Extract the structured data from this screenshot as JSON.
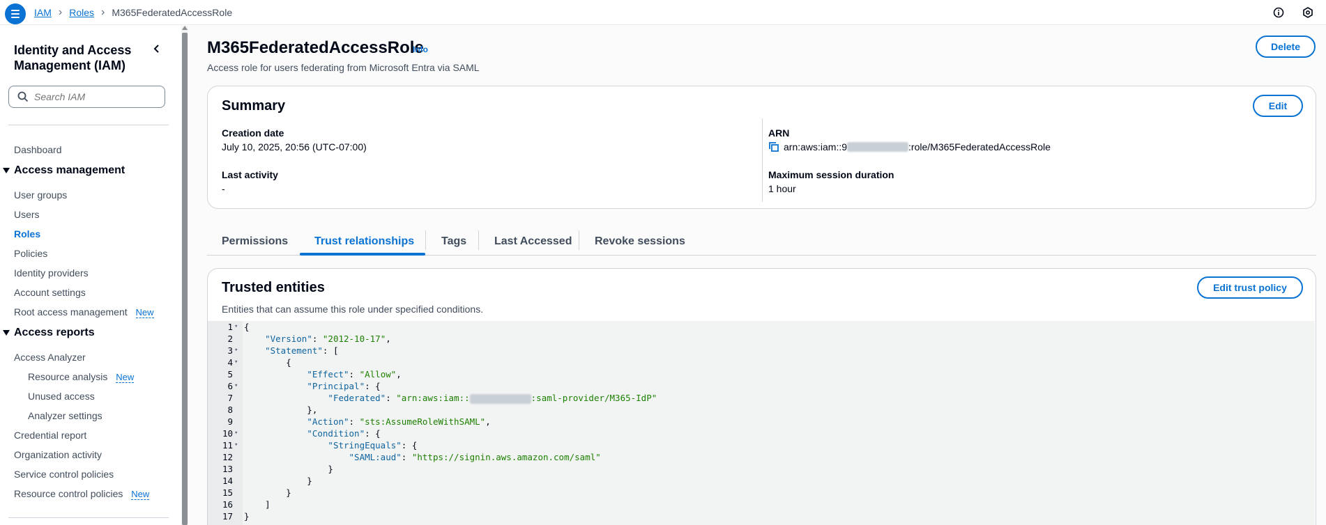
{
  "breadcrumb": [
    "IAM",
    "Roles",
    "M365FederatedAccessRole"
  ],
  "sidebar": {
    "title": "Identity and Access Management (IAM)",
    "search_placeholder": "Search IAM",
    "dashboard": "Dashboard",
    "access_management": {
      "label": "Access management",
      "items": [
        "User groups",
        "Users",
        "Roles",
        "Policies",
        "Identity providers",
        "Account settings",
        "Root access management"
      ],
      "new_badge": "New"
    },
    "access_reports": {
      "label": "Access reports",
      "analyzer": "Access Analyzer",
      "analyzer_items": [
        "Resource analysis",
        "Unused access",
        "Analyzer settings"
      ],
      "new_badge": "New",
      "items": [
        "Credential report",
        "Organization activity",
        "Service control policies",
        "Resource control policies"
      ],
      "new_badge2": "New"
    }
  },
  "page": {
    "title": "M365FederatedAccessRole",
    "info": "Info",
    "description": "Access role for users federating from Microsoft Entra via SAML",
    "delete_label": "Delete"
  },
  "summary": {
    "title": "Summary",
    "edit_label": "Edit",
    "creation_date_label": "Creation date",
    "creation_date_value": "July 10, 2025, 20:56 (UTC-07:00)",
    "last_activity_label": "Last activity",
    "last_activity_value": "-",
    "arn_label": "ARN",
    "arn_prefix": "arn:aws:iam::9",
    "arn_suffix": ":role/M365FederatedAccessRole",
    "max_session_label": "Maximum session duration",
    "max_session_value": "1 hour"
  },
  "tabs": [
    "Permissions",
    "Trust relationships",
    "Tags",
    "Last Accessed",
    "Revoke sessions"
  ],
  "trusted": {
    "title": "Trusted entities",
    "edit_label": "Edit trust policy",
    "description": "Entities that can assume this role under specified conditions."
  },
  "policy": {
    "version_key": "\"Version\"",
    "version_val": "\"2012-10-17\"",
    "statement_key": "\"Statement\"",
    "effect_key": "\"Effect\"",
    "effect_val": "\"Allow\"",
    "principal_key": "\"Principal\"",
    "federated_key": "\"Federated\"",
    "federated_prefix": "\"arn:aws:iam::",
    "federated_suffix": ":saml-provider/M365-IdP\"",
    "action_key": "\"Action\"",
    "action_val": "\"sts:AssumeRoleWithSAML\"",
    "condition_key": "\"Condition\"",
    "stringequals_key": "\"StringEquals\"",
    "aud_key": "\"SAML:aud\"",
    "aud_val": "\"https://signin.aws.amazon.com/saml\""
  }
}
